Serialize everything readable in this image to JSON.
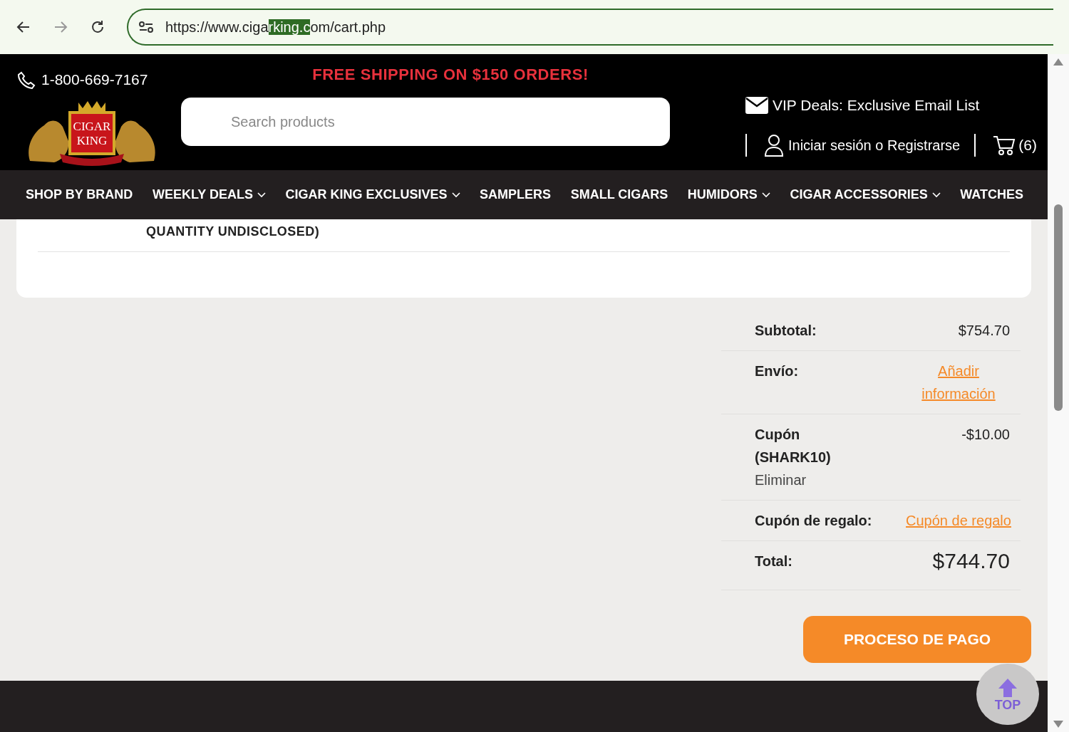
{
  "browser": {
    "url_parts": [
      "https://www.ciga",
      "rking.c",
      "om/cart.php"
    ]
  },
  "header": {
    "phone": "1-800-669-7167",
    "promo": "FREE SHIPPING ON $150 ORDERS!",
    "logo_lines": [
      "CIGAR",
      "KING"
    ],
    "search": {
      "placeholder": "Search products"
    },
    "vip": "VIP Deals: Exclusive Email List",
    "login": "Iniciar sesión o Registrarse",
    "cart_count": "(6)"
  },
  "nav": [
    {
      "label": "SHOP BY BRAND",
      "has_menu": false
    },
    {
      "label": "WEEKLY DEALS",
      "has_menu": true
    },
    {
      "label": "CIGAR KING EXCLUSIVES",
      "has_menu": true
    },
    {
      "label": "SAMPLERS",
      "has_menu": false
    },
    {
      "label": "SMALL CIGARS",
      "has_menu": false
    },
    {
      "label": "HUMIDORS",
      "has_menu": true
    },
    {
      "label": "CIGAR ACCESSORIES",
      "has_menu": true
    },
    {
      "label": "WATCHES",
      "has_menu": false
    }
  ],
  "cart_card": {
    "item_text": "QUANTITY UNDISCLOSED)"
  },
  "summary": [
    {
      "kind": "value",
      "label": "Subtotal:",
      "value": "$754.70"
    },
    {
      "kind": "link",
      "label": "Envío:",
      "value": "Añadir información"
    },
    {
      "kind": "coupon",
      "label": "Cupón (SHARK10)",
      "action": "Eliminar",
      "value": "-$10.00"
    },
    {
      "kind": "link",
      "label": "Cupón de regalo:",
      "value": "Cupón de regalo"
    },
    {
      "kind": "total",
      "label": "Total:",
      "value": "$744.70"
    }
  ],
  "checkout_button": "PROCESO DE PAGO",
  "top_button": "TOP"
}
